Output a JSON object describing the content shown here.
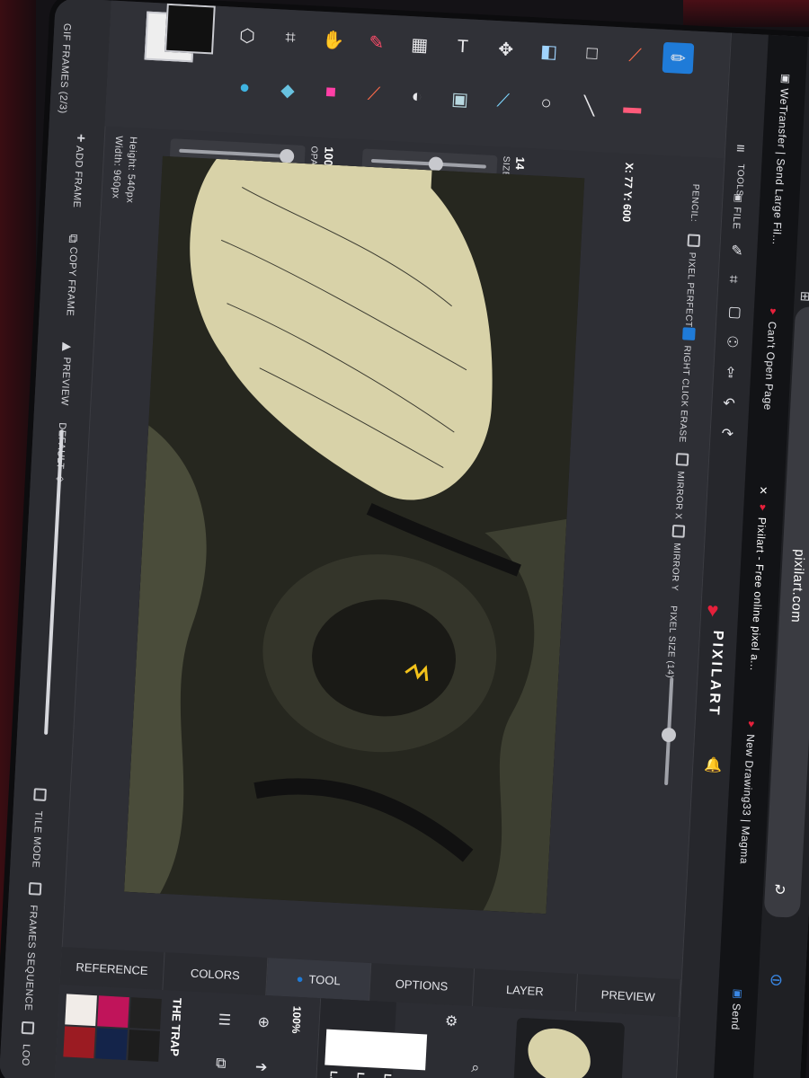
{
  "app": {
    "name": "PIXILART",
    "site": "pixilart.com"
  },
  "browser_tabs": [
    {
      "label": "WeTransfer | Send Large Fil..."
    },
    {
      "label": "Can't Open Page"
    },
    {
      "label": "Pixilart - Free online pixel a..."
    },
    {
      "label": "New Drawing33 | Magma"
    },
    {
      "label": "Send"
    }
  ],
  "left_panel": {
    "gif_frames": "GIF FRAMES (2/3)",
    "width": "Width: 960px",
    "height": "Height: 540px",
    "add_frame": "ADD FRAME",
    "copy_frame": "COPY FRAME",
    "preview": "PREVIEW",
    "default": "DEFAULT",
    "tile_mode": "TILE MODE",
    "frames_sequence": "FRAMES SEQUENCE",
    "loop": "LOO"
  },
  "toolbar": {
    "opacity_label": "OPACITY",
    "opacity_value": "100%",
    "size_label": "SIZE",
    "size_value": "14",
    "tools_label": "TOOLS",
    "coords": "X: 77 Y: 600"
  },
  "options": {
    "pencil_label": "PENCIL:",
    "pixel_perfect": "PIXEL PERFECT",
    "right_click_erase": "RIGHT CLICK ERASE",
    "mirror_x": "MIRROR X",
    "mirror_y": "MIRROR Y",
    "pixel_size": "PIXEL SIZE (14)"
  },
  "rail": {
    "file": "FILE"
  },
  "bottom_tabs": [
    {
      "label": "REFERENCE"
    },
    {
      "label": "COLORS"
    },
    {
      "label": "TOOL"
    },
    {
      "label": "OPTIONS"
    },
    {
      "label": "LAYER"
    },
    {
      "label": "PREVIEW"
    }
  ],
  "bottom": {
    "palette_name": "THE TRAP",
    "zoom": "100%",
    "layer_a": "LA",
    "layer_b": "LA",
    "layer_c": "LA"
  },
  "colors": {
    "accent": "#1f7bd8",
    "primary_color": "#111111",
    "secondary_color": "#eeeeee"
  }
}
